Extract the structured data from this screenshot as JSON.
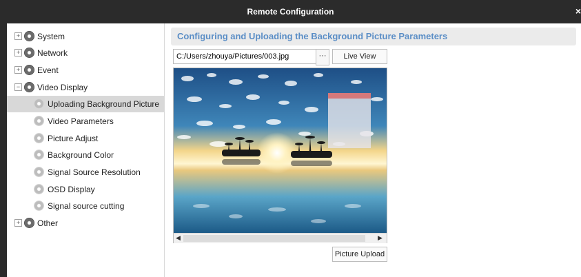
{
  "window": {
    "title": "Remote Configuration",
    "close_glyph": "×"
  },
  "tree": {
    "items": [
      {
        "label": "System",
        "expander": "+",
        "level": 0
      },
      {
        "label": "Network",
        "expander": "+",
        "level": 0
      },
      {
        "label": "Event",
        "expander": "+",
        "level": 0
      },
      {
        "label": "Video Display",
        "expander": "−",
        "level": 0
      },
      {
        "label": "Uploading Background Picture",
        "level": 1,
        "selected": true
      },
      {
        "label": "Video Parameters",
        "level": 1
      },
      {
        "label": "Picture Adjust",
        "level": 1
      },
      {
        "label": "Background Color",
        "level": 1
      },
      {
        "label": "Signal Source Resolution",
        "level": 1
      },
      {
        "label": "OSD Display",
        "level": 1
      },
      {
        "label": "Signal source cutting",
        "level": 1
      },
      {
        "label": "Other",
        "expander": "+",
        "level": 0
      }
    ]
  },
  "panel": {
    "heading": "Configuring and Uploading the Background Picture Parameters",
    "file_path": "C:/Users/zhouya/Pictures/003.jpg",
    "browse_label": "···",
    "live_view_label": "Live View",
    "upload_label": "Picture Upload"
  },
  "preview": {
    "scroll_left": "◀",
    "scroll_right": "▶"
  },
  "colors": {
    "titlebar": "#2b2b2b",
    "heading_text": "#5b8ec6",
    "selection": "#d8d8d8"
  }
}
